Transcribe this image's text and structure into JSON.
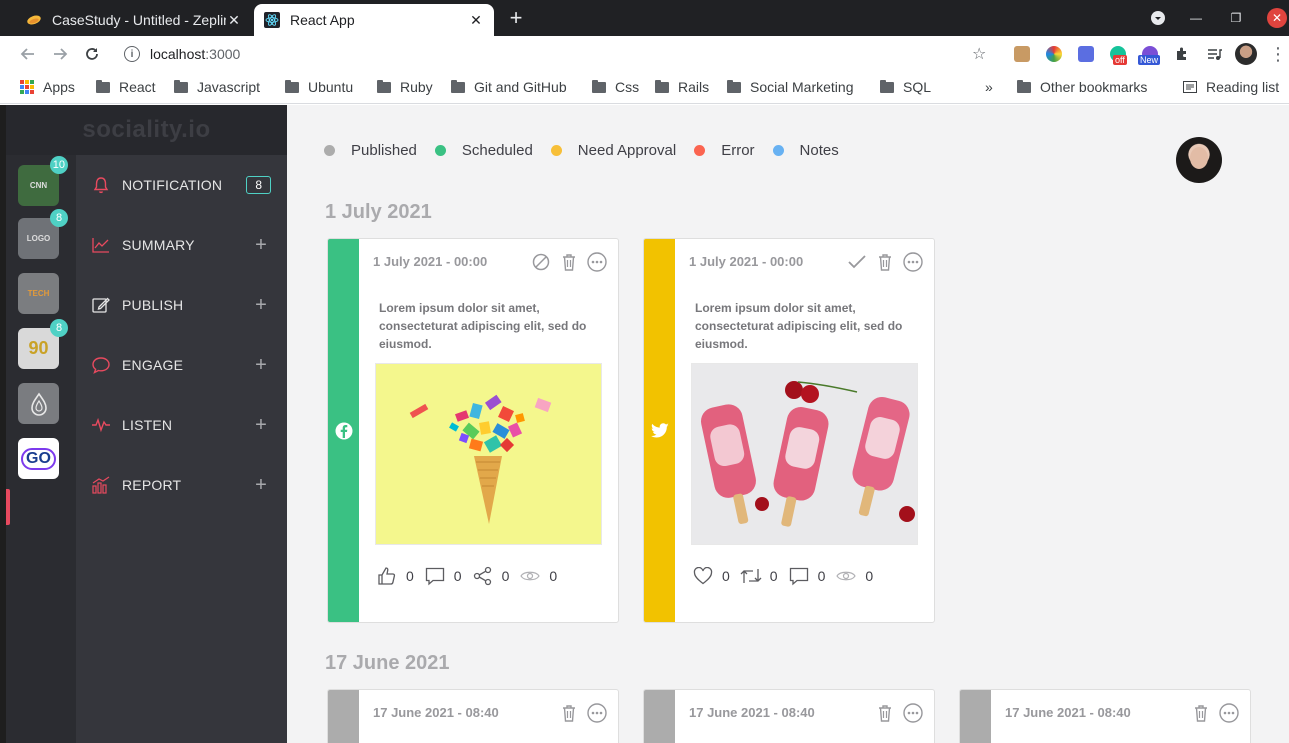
{
  "browser": {
    "tabs": [
      {
        "title": "CaseStudy - Untitled - Zeplin",
        "active": false
      },
      {
        "title": "React App",
        "active": true
      }
    ],
    "url": {
      "host": "localhost",
      "port": ":3000"
    },
    "bookmarks": [
      "Apps",
      "React",
      "Javascript",
      "Ubuntu",
      "Ruby",
      "Git and GitHub",
      "Css",
      "Rails",
      "Social Marketing",
      "SQL"
    ],
    "overflow": "»",
    "other_bookmarks": "Other bookmarks",
    "reading_list": "Reading list",
    "extension_badges": {
      "off": "off",
      "new": "New"
    }
  },
  "app": {
    "brand": "sociality.io",
    "accounts": [
      {
        "name": "account-1",
        "badge": "10",
        "tile_text": "CNN"
      },
      {
        "name": "account-2",
        "badge": "8",
        "tile_text": "LOGO"
      },
      {
        "name": "account-3",
        "badge": "",
        "tile_text": "TECH"
      },
      {
        "name": "account-4",
        "badge": "8",
        "tile_text": "90"
      },
      {
        "name": "account-5",
        "badge": "",
        "tile_text": ""
      },
      {
        "name": "account-6",
        "badge": "",
        "tile_text": "GO"
      }
    ],
    "menu": [
      {
        "label": "NOTIFICATION",
        "count": "8",
        "icon": "bell-icon"
      },
      {
        "label": "SUMMARY",
        "icon": "chart-icon"
      },
      {
        "label": "PUBLISH",
        "icon": "edit-icon"
      },
      {
        "label": "ENGAGE",
        "icon": "chat-icon"
      },
      {
        "label": "LISTEN",
        "icon": "pulse-icon"
      },
      {
        "label": "REPORT",
        "icon": "report-icon"
      }
    ],
    "plus": "+"
  },
  "legend": [
    {
      "label": "Published",
      "color": "#acacac"
    },
    {
      "label": "Scheduled",
      "color": "#3ac183"
    },
    {
      "label": "Need Approval",
      "color": "#f7bf38"
    },
    {
      "label": "Error",
      "color": "#fb6450"
    },
    {
      "label": "Notes",
      "color": "#67b1f2"
    }
  ],
  "groups": [
    {
      "date": "1 July 2021",
      "posts": [
        {
          "time": "1 July 2021 - 00:00",
          "network": "facebook",
          "status_color": "#3ac183",
          "text": "Lorem ipsum dolor sit amet, consecteturat adipiscing elit, sed do eiusmod.",
          "stats": [
            "0",
            "0",
            "0",
            "0"
          ]
        },
        {
          "time": "1 July 2021 - 00:00",
          "network": "twitter",
          "status_color": "#f7bf38",
          "text": "Lorem ipsum dolor sit amet, consecteturat adipiscing elit, sed do eiusmod.",
          "stats": [
            "0",
            "0",
            "0",
            "0"
          ]
        }
      ]
    },
    {
      "date": "17 June 2021",
      "posts": [
        {
          "time": "17 June 2021 - 08:40"
        },
        {
          "time": "17 June 2021 - 08:40"
        },
        {
          "time": "17 June 2021 - 08:40"
        }
      ]
    }
  ]
}
